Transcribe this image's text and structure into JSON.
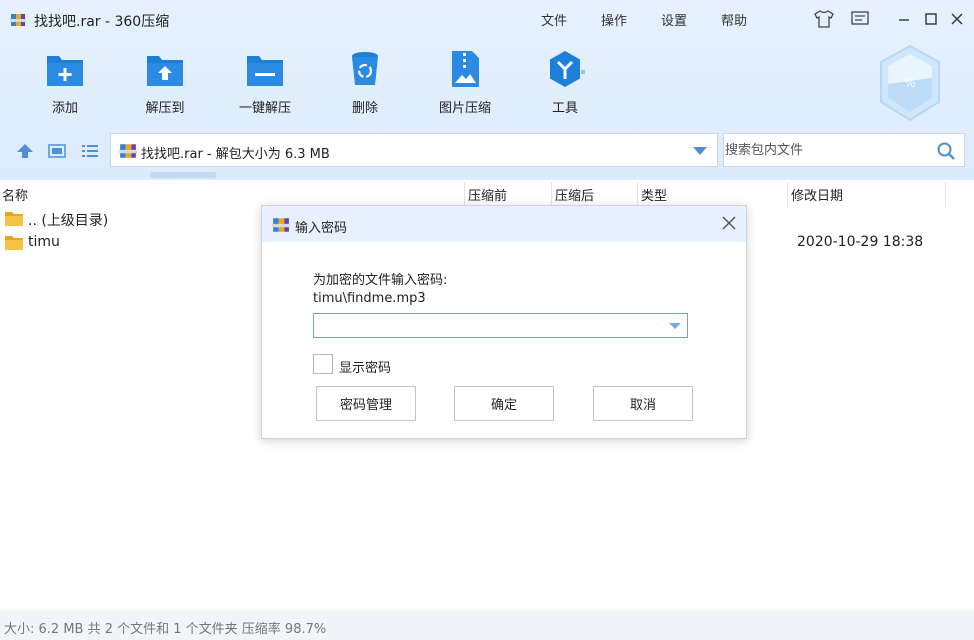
{
  "window": {
    "title": "找找吧.rar - 360压缩"
  },
  "menu": {
    "file": "文件",
    "operate": "操作",
    "settings": "设置",
    "help": "帮助"
  },
  "toolbar": {
    "add": "添加",
    "extract_to": "解压到",
    "one_click_extract": "一键解压",
    "delete": "删除",
    "image_compress": "图片压缩",
    "tools": "工具"
  },
  "gem": {
    "text": "%"
  },
  "address": {
    "path": "找找吧.rar - 解包大小为 6.3 MB"
  },
  "search": {
    "placeholder": "搜索包内文件"
  },
  "columns": {
    "name": "名称",
    "before": "压缩前",
    "after": "压缩后",
    "type": "类型",
    "modified": "修改日期"
  },
  "rows": [
    {
      "name": ".. (上级目录)",
      "date": ""
    },
    {
      "name": "timu",
      "date": "2020-10-29 18:38"
    }
  ],
  "status": {
    "text": "大小: 6.2 MB 共 2 个文件和 1 个文件夹 压缩率 98.7%"
  },
  "dialog": {
    "title": "输入密码",
    "prompt": "为加密的文件输入密码:",
    "file": "timu\\findme.mp3",
    "password_value": "",
    "show_password": "显示密码",
    "manage": "密码管理",
    "ok": "确定",
    "cancel": "取消"
  },
  "colors": {
    "accent": "#1e7fd8",
    "header_bg": "#e6f1fd",
    "folder": "#f5c243"
  }
}
